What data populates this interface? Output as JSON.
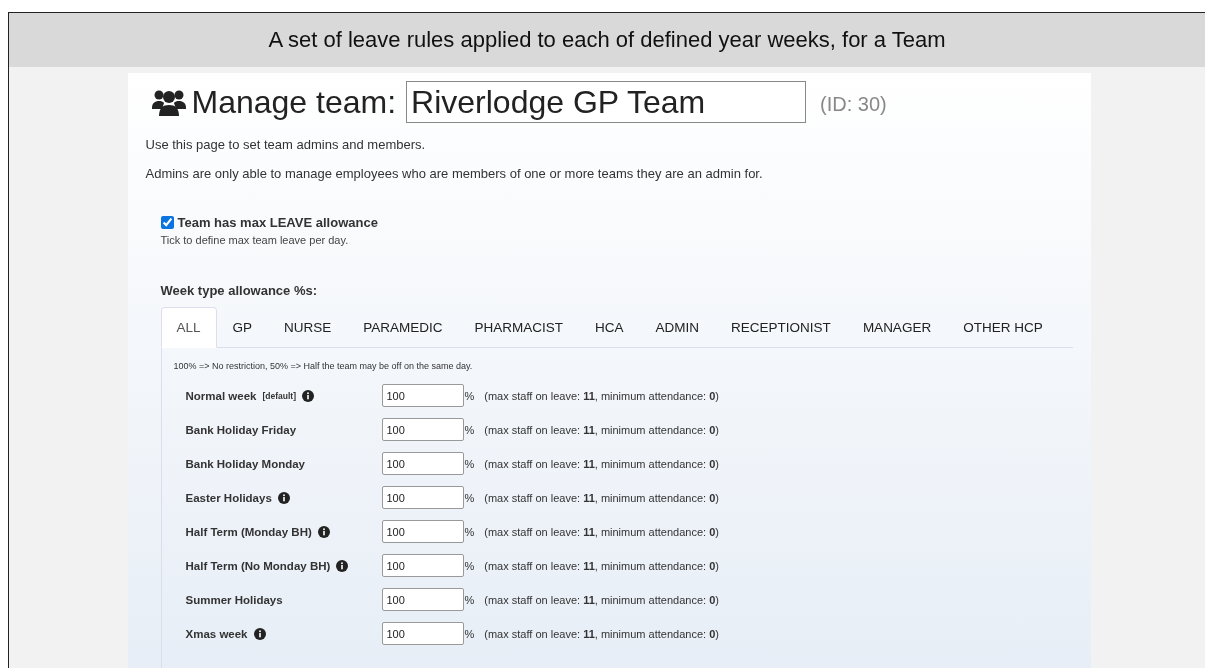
{
  "caption": "A set of leave rules applied to each of defined year weeks, for a Team",
  "header": {
    "title": "Manage team:",
    "team_name": "Riverlodge GP Team",
    "id_label": "(ID: 30)"
  },
  "intro": [
    "Use this page to set team admins and members.",
    "Admins are only able to manage employees who are members of one or more teams they are an admin for."
  ],
  "max_leave": {
    "label": "Team has max LEAVE allowance",
    "checked": true,
    "hint": "Tick to define max team leave per day."
  },
  "allowance_heading": "Week type allowance %s:",
  "tabs": [
    {
      "label": "ALL",
      "selected": true
    },
    {
      "label": "GP",
      "selected": false
    },
    {
      "label": "NURSE",
      "selected": false
    },
    {
      "label": "PARAMEDIC",
      "selected": false
    },
    {
      "label": "PHARMACIST",
      "selected": false
    },
    {
      "label": "HCA",
      "selected": false
    },
    {
      "label": "ADMIN",
      "selected": false
    },
    {
      "label": "RECEPTIONIST",
      "selected": false
    },
    {
      "label": "MANAGER",
      "selected": false
    },
    {
      "label": "OTHER HCP",
      "selected": false
    }
  ],
  "tab_note": "100% => No restriction, 50% => Half the team may be off on the same day.",
  "weeks": [
    {
      "name": "Normal week",
      "tag": "[default]",
      "info": true,
      "value": "100",
      "unit": "%",
      "detail": "(max staff on leave: **11**, minimum attendance: **0**)"
    },
    {
      "name": "Bank Holiday Friday",
      "info": false,
      "value": "100",
      "unit": "%",
      "detail": "(max staff on leave: **11**, minimum attendance: **0**)"
    },
    {
      "name": "Bank Holiday Monday",
      "info": false,
      "value": "100",
      "unit": "%",
      "detail": "(max staff on leave: **11**, minimum attendance: **0**)"
    },
    {
      "name": "Easter Holidays",
      "info": true,
      "value": "100",
      "unit": "%",
      "detail": "(max staff on leave: **11**, minimum attendance: **0**)"
    },
    {
      "name": "Half Term (Monday BH)",
      "info": true,
      "value": "100",
      "unit": "%",
      "detail": "(max staff on leave: **11**, minimum attendance: **0**)"
    },
    {
      "name": "Half Term (No Monday BH)",
      "info": true,
      "value": "100",
      "unit": "%",
      "detail": "(max staff on leave: **11**, minimum attendance: **0**)"
    },
    {
      "name": "Summer Holidays",
      "info": false,
      "value": "100",
      "unit": "%",
      "detail": "(max staff on leave: **11**, minimum attendance: **0**)"
    },
    {
      "name": "Xmas week",
      "info": true,
      "value": "100",
      "unit": "%",
      "detail": "(max staff on leave: **11**, minimum attendance: **0**)"
    }
  ]
}
